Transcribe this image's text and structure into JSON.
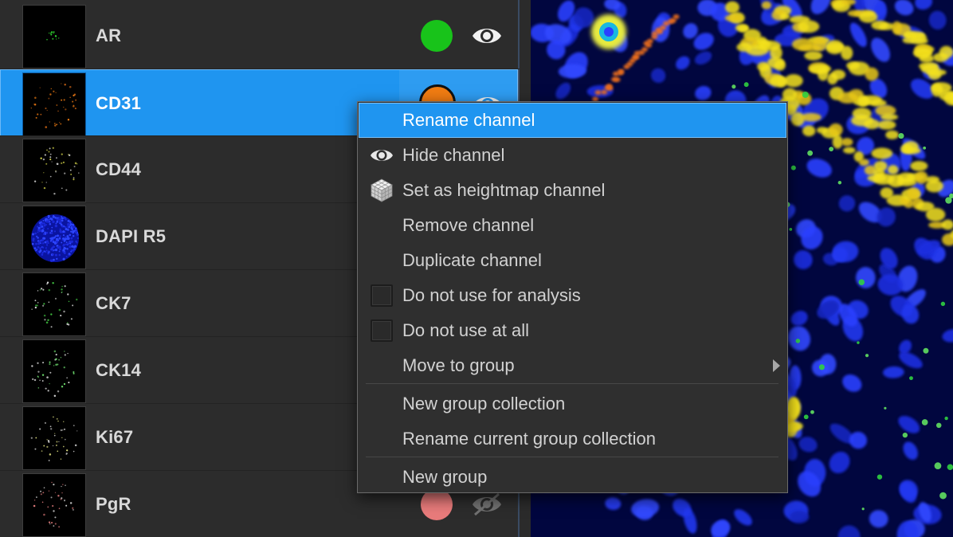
{
  "channels": [
    {
      "label": "AR",
      "color": "#18c31a",
      "visible": true,
      "selected": false,
      "thumb": "ar"
    },
    {
      "label": "CD31",
      "color": "#f07c12",
      "visible": true,
      "selected": true,
      "thumb": "cd31"
    },
    {
      "label": "CD44",
      "color": "#d8d8d8",
      "visible": true,
      "selected": false,
      "thumb": "cd44"
    },
    {
      "label": "DAPI R5",
      "color": "#2233ff",
      "visible": true,
      "selected": false,
      "thumb": "dapi"
    },
    {
      "label": "CK7",
      "color": "#d8d8d8",
      "visible": true,
      "selected": false,
      "thumb": "ck7"
    },
    {
      "label": "CK14",
      "color": "#d8d8d8",
      "visible": true,
      "selected": false,
      "thumb": "ck14"
    },
    {
      "label": "Ki67",
      "color": "#d8d8d8",
      "visible": true,
      "selected": false,
      "thumb": "ki67"
    },
    {
      "label": "PgR",
      "color": "#e87b7b",
      "visible": false,
      "selected": false,
      "thumb": "pgr"
    }
  ],
  "context_menu": {
    "items": [
      {
        "label": "Rename channel",
        "icon": "none",
        "highlighted": true
      },
      {
        "label": "Hide channel",
        "icon": "eye-icon"
      },
      {
        "label": "Set as heightmap channel",
        "icon": "cube-grid-icon"
      },
      {
        "label": "Remove channel",
        "icon": "none"
      },
      {
        "label": "Duplicate channel",
        "icon": "none"
      },
      {
        "label": "Do not use for analysis",
        "icon": "checkbox",
        "checked": false
      },
      {
        "label": "Do not use at all",
        "icon": "checkbox",
        "checked": false
      },
      {
        "label": "Move to group",
        "icon": "none",
        "submenu": true
      },
      {
        "label": "New group collection",
        "icon": "none"
      },
      {
        "label": "Rename current group collection",
        "icon": "none"
      },
      {
        "label": "New group",
        "icon": "none"
      }
    ]
  },
  "colors": {
    "selection": "#1f95f0",
    "panel_bg": "#2c2c2c",
    "menu_bg": "#2f2f2f",
    "nucleus": "#1530e8",
    "membrane": "#f0e020"
  }
}
